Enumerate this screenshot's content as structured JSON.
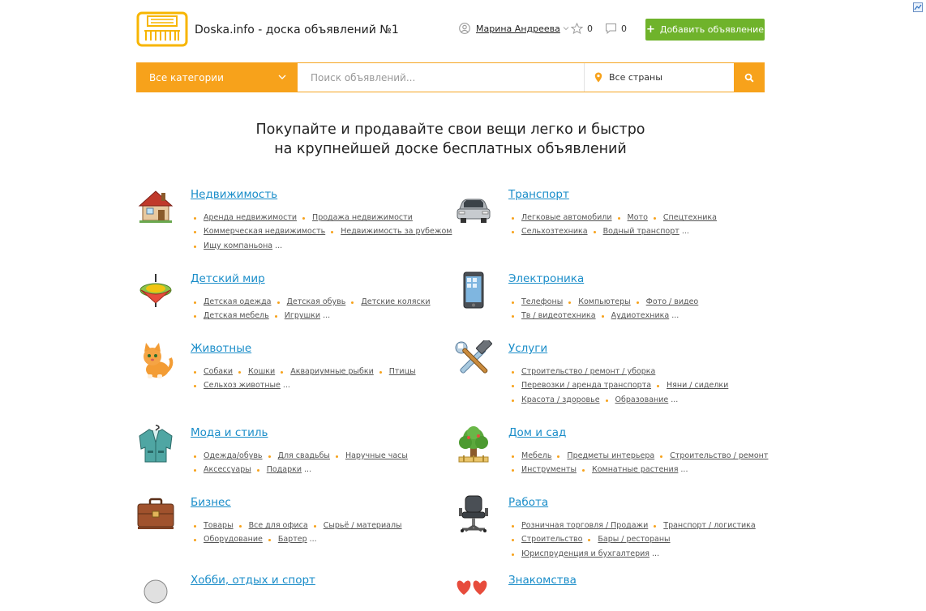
{
  "header": {
    "site_title": "Doska.info - доска объявлений №1",
    "user_name": "Марина Андреева",
    "favorites_count": "0",
    "messages_count": "0",
    "add_button_label": "Добавить объявление"
  },
  "search": {
    "category_label": "Все категории",
    "placeholder": "Поиск объявлений...",
    "country_label": "Все страны"
  },
  "hero": {
    "line1": "Покупайте и продавайте свои вещи легко и быстро",
    "line2": "на крупнейшей доске бесплатных объявлений"
  },
  "colors": {
    "accent": "#f7a21b",
    "link": "#1a8dc9",
    "button": "#6fb32b"
  },
  "categories": [
    {
      "title": "Недвижимость",
      "icon": "house-icon",
      "lines": [
        [
          "Аренда недвижимости",
          "Продажа недвижимости"
        ],
        [
          "Коммерческая недвижимость",
          "Недвижимость за рубежом"
        ],
        [
          "Ищу компаньона"
        ]
      ],
      "more": "..."
    },
    {
      "title": "Транспорт",
      "icon": "car-icon",
      "lines": [
        [
          "Легковые автомобили",
          "Мото",
          "Спецтехника"
        ],
        [
          "Сельхозтехника",
          "Водный транспорт"
        ]
      ],
      "more": "..."
    },
    {
      "title": "Детский мир",
      "icon": "spinning-top-icon",
      "lines": [
        [
          "Детская одежда",
          "Детская обувь",
          "Детские коляски"
        ],
        [
          "Детская мебель",
          "Игрушки"
        ]
      ],
      "more": "..."
    },
    {
      "title": "Электроника",
      "icon": "smartphone-icon",
      "lines": [
        [
          "Телефоны",
          "Компьютеры",
          "Фото / видео"
        ],
        [
          "Тв / видеотехника",
          "Аудиотехника"
        ]
      ],
      "more": "..."
    },
    {
      "title": "Животные",
      "icon": "kitten-icon",
      "lines": [
        [
          "Собаки",
          "Кошки",
          "Аквариумные рыбки",
          "Птицы"
        ],
        [
          "Сельхоз животные"
        ]
      ],
      "more": "..."
    },
    {
      "title": "Услуги",
      "icon": "tools-icon",
      "lines": [
        [
          "Строительство / ремонт / уборка"
        ],
        [
          "Перевозки / аренда транспорта",
          "Няни / сиделки"
        ],
        [
          "Красота / здоровье",
          "Образование"
        ]
      ],
      "more": "..."
    },
    {
      "title": "Мода и стиль",
      "icon": "jacket-icon",
      "lines": [
        [
          "Одежда/обувь",
          "Для свадьбы",
          "Наручные часы"
        ],
        [
          "Аксессуары",
          "Подарки"
        ]
      ],
      "more": "..."
    },
    {
      "title": "Дом и сад",
      "icon": "tree-icon",
      "lines": [
        [
          "Мебель",
          "Предметы интерьера",
          "Строительство / ремонт"
        ],
        [
          "Инструменты",
          "Комнатные растения"
        ]
      ],
      "more": "..."
    },
    {
      "title": "Бизнес",
      "icon": "briefcase-icon",
      "lines": [
        [
          "Товары",
          "Все для офиса",
          "Сырьё / материалы"
        ],
        [
          "Оборудование",
          "Бартер"
        ]
      ],
      "more": "..."
    },
    {
      "title": "Работа",
      "icon": "office-chair-icon",
      "lines": [
        [
          "Розничная торговля / Продажи",
          "Транспорт / логистика"
        ],
        [
          "Строительство",
          "Бары / рестораны"
        ],
        [
          "Юриспруденция и бухгалтерия"
        ]
      ],
      "more": "..."
    },
    {
      "title": "Хобби, отдых и спорт",
      "icon": "hobby-icon",
      "lines": [],
      "more": ""
    },
    {
      "title": "Знакомства",
      "icon": "hearts-icon",
      "lines": [],
      "more": ""
    }
  ]
}
